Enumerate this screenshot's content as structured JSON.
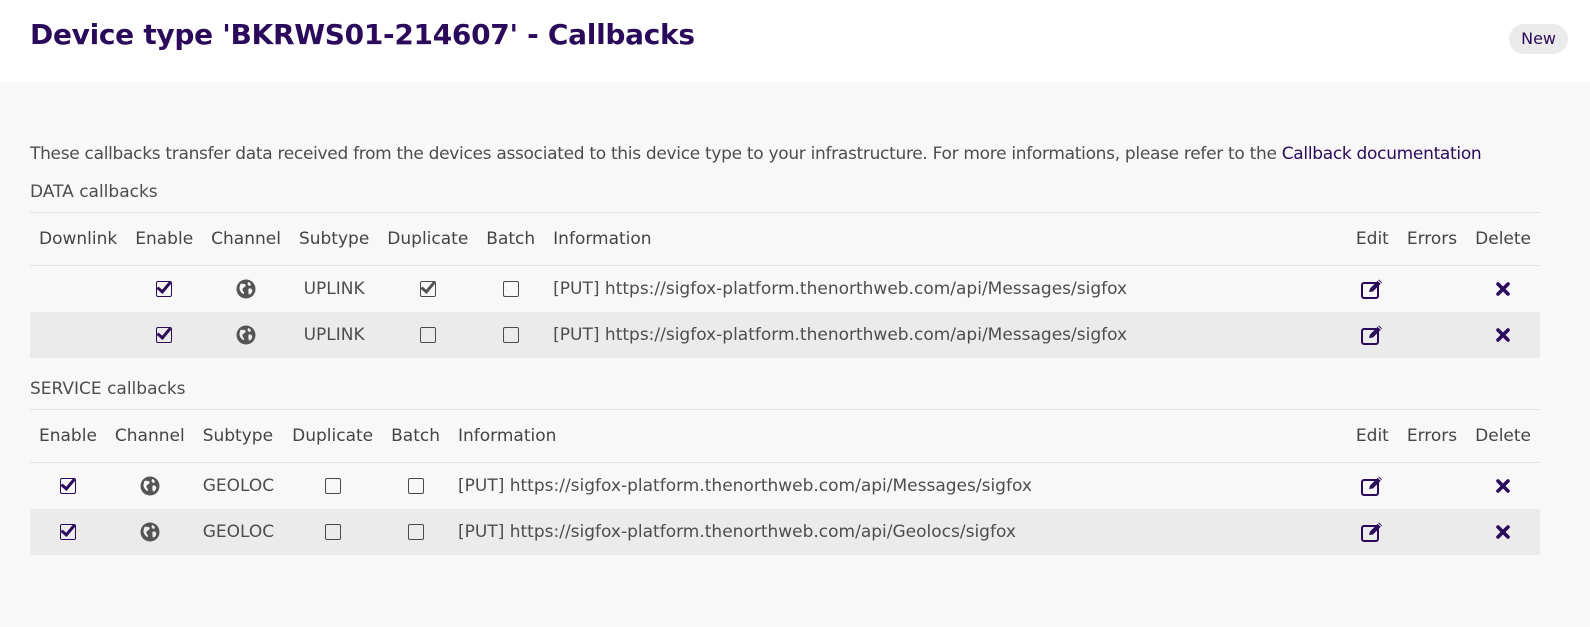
{
  "header": {
    "title": "Device type 'BKRWS01-214607' - Callbacks",
    "new_label": "New"
  },
  "intro": {
    "text": "These callbacks transfer data received from the devices associated to this device type to your infrastructure. For more informations, please refer to the ",
    "link_label": "Callback documentation"
  },
  "data_callbacks": {
    "title": "DATA callbacks",
    "columns": [
      "Downlink",
      "Enable",
      "Channel",
      "Subtype",
      "Duplicate",
      "Batch",
      "Information",
      "Edit",
      "Errors",
      "Delete"
    ],
    "rows": [
      {
        "downlink": "",
        "enable": true,
        "channel_icon": "globe-icon",
        "subtype": "UPLINK",
        "duplicate": true,
        "batch": false,
        "information": "[PUT] https://sigfox-platform.thenorthweb.com/api/Messages/sigfox",
        "errors": ""
      },
      {
        "downlink": "",
        "enable": true,
        "channel_icon": "globe-icon",
        "subtype": "UPLINK",
        "duplicate": false,
        "batch": false,
        "information": "[PUT] https://sigfox-platform.thenorthweb.com/api/Messages/sigfox",
        "errors": ""
      }
    ]
  },
  "service_callbacks": {
    "title": "SERVICE callbacks",
    "columns": [
      "Enable",
      "Channel",
      "Subtype",
      "Duplicate",
      "Batch",
      "Information",
      "Edit",
      "Errors",
      "Delete"
    ],
    "rows": [
      {
        "enable": true,
        "channel_icon": "globe-icon",
        "subtype": "GEOLOC",
        "duplicate": false,
        "batch": false,
        "information": "[PUT] https://sigfox-platform.thenorthweb.com/api/Messages/sigfox",
        "errors": ""
      },
      {
        "enable": true,
        "channel_icon": "globe-icon",
        "subtype": "GEOLOC",
        "duplicate": false,
        "batch": false,
        "information": "[PUT] https://sigfox-platform.thenorthweb.com/api/Geolocs/sigfox",
        "errors": ""
      }
    ]
  },
  "colors": {
    "brand": "#2b0a5c",
    "page_bg": "#f8f8f8",
    "row_alt": "#ebebeb",
    "text": "#4d4d4d"
  }
}
